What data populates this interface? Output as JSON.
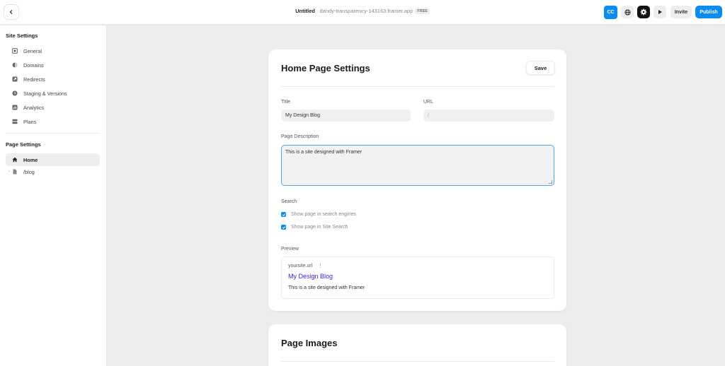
{
  "topbar": {
    "project_title": "Untitled",
    "separator": "·",
    "domain": "dandy-transparency-143163.framer.app",
    "plan_badge": "FREE",
    "avatar_initials": "CC",
    "invite_label": "Invite",
    "publish_label": "Publish"
  },
  "sidebar": {
    "site_heading": "Site Settings",
    "site_items": [
      {
        "label": "General",
        "icon": "square-icon"
      },
      {
        "label": "Domains",
        "icon": "globe-icon"
      },
      {
        "label": "Redirects",
        "icon": "redirect-icon"
      },
      {
        "label": "Staging & Versions",
        "icon": "clock-icon"
      },
      {
        "label": "Analytics",
        "icon": "chart-icon"
      },
      {
        "label": "Plans",
        "icon": "layers-icon"
      }
    ],
    "page_heading": "Page Settings",
    "page_items": [
      {
        "label": "Home",
        "icon": "home-icon",
        "active": true
      },
      {
        "label": "/blog",
        "icon": "file-icon",
        "active": false
      }
    ]
  },
  "main": {
    "card_title": "Home Page Settings",
    "save_label": "Save",
    "title_label": "Title",
    "title_value": "My Design Blog",
    "url_label": "URL",
    "url_value": "/",
    "description_label": "Page Description",
    "description_value": "This is a site designed with Framer",
    "search_label": "Search",
    "search_options": [
      {
        "label": "Show page in search engines",
        "checked": true
      },
      {
        "label": "Show page in Site Search",
        "checked": true
      }
    ],
    "preview_label": "Preview",
    "preview": {
      "url": "yoursite.url",
      "dots": "⋮",
      "title": "My Design Blog",
      "description": "This is a site designed with Framer"
    },
    "images_title": "Page Images"
  },
  "colors": {
    "accent": "#0a8cf0",
    "preview_title": "#3a1fd0",
    "canvas_bg": "#ededed"
  }
}
